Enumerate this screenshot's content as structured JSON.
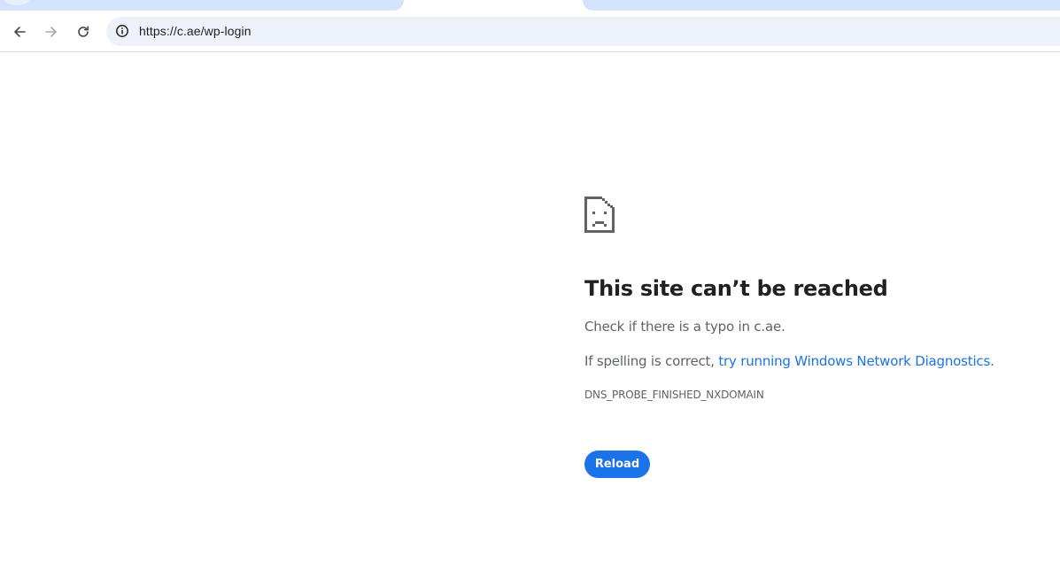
{
  "toolbar": {
    "back_icon": "arrow-left-icon",
    "forward_icon": "arrow-right-icon",
    "reload_icon": "reload-icon",
    "site_info_icon": "info-icon",
    "url": "https://c.ae/wp-login"
  },
  "error_page": {
    "icon": "sad-document-icon",
    "heading": "This site can’t be reached",
    "typo_message": "Check if there is a typo in c.ae.",
    "spelling_prefix": "If spelling is correct, ",
    "diagnostics_link": "try running Windows Network Diagnostics",
    "spelling_suffix": ".",
    "error_code": "DNS_PROBE_FINISHED_NXDOMAIN",
    "reload_label": "Reload"
  },
  "colors": {
    "accent": "#1a73e8",
    "heading_text": "#202124",
    "body_text": "#5f6368",
    "omnibox_bg": "#edf2fa",
    "tab_bg": "#d3e3fd"
  }
}
